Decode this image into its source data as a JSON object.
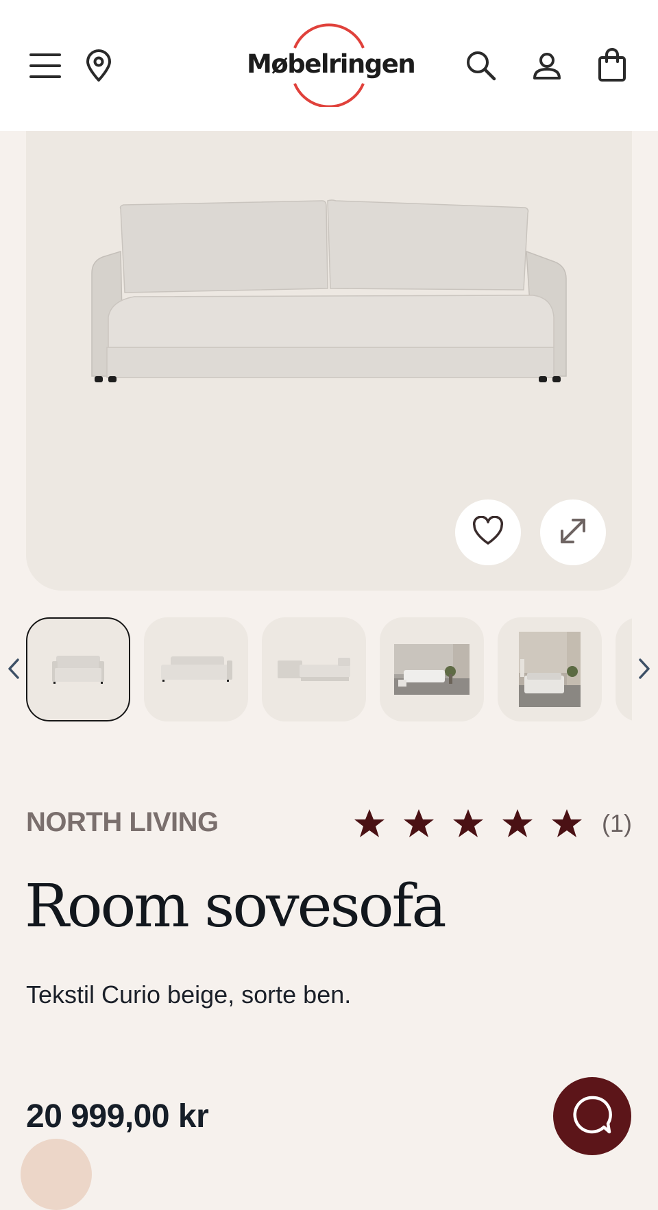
{
  "header": {
    "logo_text": "Møbelringen",
    "icons": [
      "menu-icon",
      "location-pin-icon",
      "search-icon",
      "user-icon",
      "shopping-bag-icon"
    ]
  },
  "gallery": {
    "actions": [
      "heart-icon",
      "expand-icon"
    ],
    "thumbnail_count_visible": 5,
    "active_index": 0
  },
  "product": {
    "brand": "NORTH LIVING",
    "rating": 5,
    "review_count": "(1)",
    "title": "Room sovesofa",
    "description": "Tekstil Curio beige, sorte ben.",
    "price": "20 999,00 kr"
  },
  "colors": {
    "accent": "#e0413b",
    "star": "#4a1114",
    "chat": "#5c1519",
    "background": "#f6f1ed",
    "image_bg": "#ede8e2"
  }
}
